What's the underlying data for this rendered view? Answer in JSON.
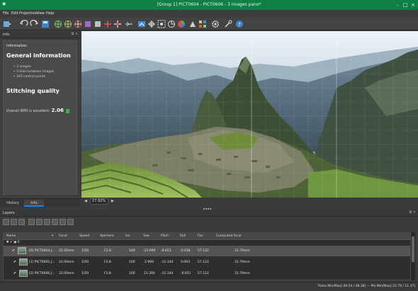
{
  "window": {
    "title": "[Group 1] PICT0604 - PICT0606 - 3 images pano*",
    "app_icon": "hugin-icon"
  },
  "menu": [
    "File",
    "Edit",
    "Projection",
    "View",
    "Help"
  ],
  "info_panel": {
    "header": "Info",
    "section_label": "Information",
    "general_heading": "General information",
    "general_items": [
      "3 images",
      "3 links between images",
      "193 control points"
    ],
    "quality_heading": "Stitching quality",
    "rms_label": "Overall RMS is excellent:",
    "rms_value": "2.06",
    "rms_status_color": "#36b24b"
  },
  "left_tabs": [
    {
      "label": "History",
      "active": false
    },
    {
      "label": "Info",
      "active": true
    }
  ],
  "preview": {
    "zoom": "17.92%"
  },
  "layers": {
    "title": "Layers",
    "columns": [
      "Name",
      "Focal",
      "Speed",
      "Aperture",
      "Iso",
      "Yaw",
      "Pitch",
      "Roll",
      "Fov",
      "Computed focal"
    ],
    "group_label": "▼ ✔ ▣ 0",
    "rows": [
      {
        "name": "[0] PICT0604.J...",
        "focal": "22.00mm",
        "speed": "1/50",
        "aperture": "F2.8",
        "iso": "100",
        "yaw": "-23.999",
        "pitch": "-8.023",
        "roll": "-0.038",
        "fov": "57.122",
        "computed": "31.79mm",
        "selected": true
      },
      {
        "name": "[1] PICT0605.J...",
        "focal": "22.00mm",
        "speed": "1/50",
        "aperture": "F2.8",
        "iso": "100",
        "yaw": "2.969",
        "pitch": "-11.144",
        "roll": "0.063",
        "fov": "57.122",
        "computed": "31.79mm",
        "selected": false
      },
      {
        "name": "[2] PICT0606.J...",
        "focal": "22.00mm",
        "speed": "1/50",
        "aperture": "F2.8",
        "iso": "100",
        "yaw": "21.300",
        "pitch": "-11.144",
        "roll": "-0.051",
        "fov": "57.122",
        "computed": "31.79mm",
        "selected": false
      }
    ]
  },
  "statusbar": {
    "text": "Theta Min/Max[-49.54 / 48.38] — Phi Min/Max[-22.79 / 11.37]"
  },
  "colors": {
    "titlebar": "#0f7f44",
    "selection": "#545454",
    "tab_accent": "#2b7bd6"
  },
  "icons": {
    "toolbar": [
      "new-project-icon",
      "open-icon",
      "undo-icon",
      "redo-icon",
      "save-icon",
      "align-icon",
      "control-points-icon",
      "crop-icon",
      "mask-icon",
      "stitch-icon",
      "fov-icon",
      "fit-icon",
      "zoom-icon",
      "pan-icon",
      "move-icon",
      "center-icon",
      "color-icon",
      "exposure-icon",
      "settings-icon",
      "tools-icon",
      "help-icon"
    ]
  }
}
